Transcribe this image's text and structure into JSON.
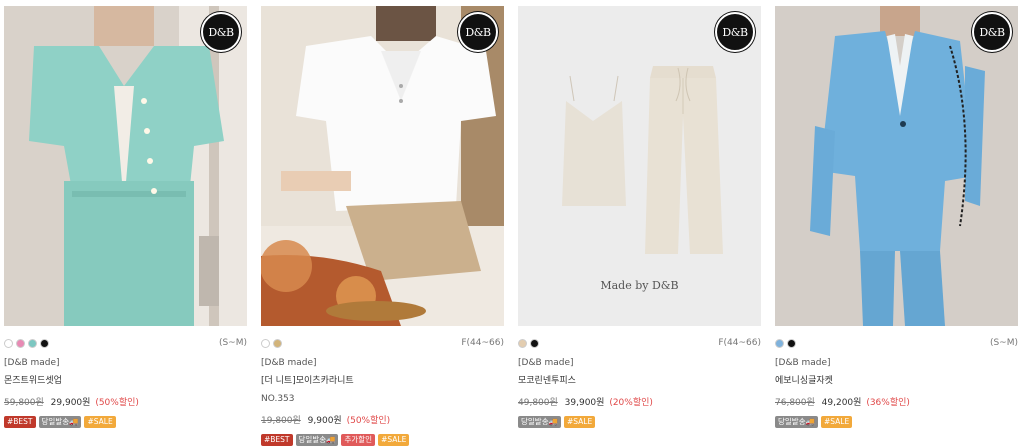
{
  "logo_text": "D&B",
  "products": [
    {
      "swatches": [
        "#ffffff",
        "#e88ab4",
        "#7cc7c1",
        "#111111"
      ],
      "size": "(S~M)",
      "brand": "[D&B made]",
      "name": "몬즈트위드셋업",
      "code": "",
      "price_original": "59,800원",
      "price_sale": "29,900원",
      "discount": "(50%할인)",
      "tags": [
        {
          "label": "#BEST",
          "color": "#c0392b"
        },
        {
          "label": "당일발송🚚",
          "color": "#8a8a8a"
        },
        {
          "label": "#SALE",
          "color": "#f2a93b"
        }
      ],
      "caption": ""
    },
    {
      "swatches": [
        "#ffffff",
        "#d2b47a"
      ],
      "size": "F(44~66)",
      "brand": "[D&B made]",
      "name": "[더 니트]모이츠카라니트",
      "code": "NO.353",
      "price_original": "19,800원",
      "price_sale": "9,900원",
      "discount": "(50%할인)",
      "tags": [
        {
          "label": "#BEST",
          "color": "#c0392b"
        },
        {
          "label": "당일발송🚚",
          "color": "#8a8a8a"
        },
        {
          "label": "추가할인",
          "color": "#e05a5a"
        },
        {
          "label": "#SALE",
          "color": "#f2a93b"
        }
      ],
      "caption": ""
    },
    {
      "swatches": [
        "#e3cdb0",
        "#111111"
      ],
      "size": "F(44~66)",
      "brand": "[D&B made]",
      "name": "모코린넨투피스",
      "code": "",
      "price_original": "49,800원",
      "price_sale": "39,900원",
      "discount": "(20%할인)",
      "tags": [
        {
          "label": "당일발송🚚",
          "color": "#8a8a8a"
        },
        {
          "label": "#SALE",
          "color": "#f2a93b"
        }
      ],
      "caption": "Made by D&B"
    },
    {
      "swatches": [
        "#7fb2dc",
        "#111111"
      ],
      "size": "(S~M)",
      "brand": "[D&B made]",
      "name": "에보니싱글자켓",
      "code": "",
      "price_original": "76,800원",
      "price_sale": "49,200원",
      "discount": "(36%할인)",
      "tags": [
        {
          "label": "당일발송🚚",
          "color": "#8a8a8a"
        },
        {
          "label": "#SALE",
          "color": "#f2a93b"
        }
      ],
      "caption": ""
    }
  ]
}
